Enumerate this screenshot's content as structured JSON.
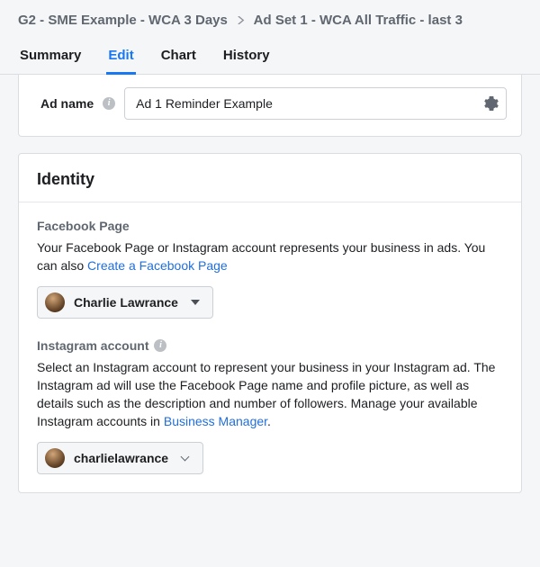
{
  "breadcrumb": {
    "campaign": "G2 - SME Example - WCA 3 Days",
    "adset": "Ad Set 1 - WCA All Traffic - last 3"
  },
  "tabs": {
    "summary": "Summary",
    "edit": "Edit",
    "chart": "Chart",
    "history": "History"
  },
  "ad_name": {
    "label": "Ad name",
    "value": "Ad 1 Reminder Example"
  },
  "identity": {
    "heading": "Identity",
    "facebook": {
      "title": "Facebook Page",
      "description_pre": "Your Facebook Page or Instagram account represents your business in ads. You can also ",
      "create_link": "Create a Facebook Page",
      "selected_page": "Charlie Lawrance"
    },
    "instagram": {
      "title": "Instagram account",
      "description_pre": "Select an Instagram account to represent your business in your Instagram ad. The Instagram ad will use the Facebook Page name and profile picture, as well as details such as the description and number of followers. Manage your available Instagram accounts in ",
      "manager_link": "Business Manager",
      "description_post": ".",
      "selected_account": "charlielawrance"
    }
  }
}
